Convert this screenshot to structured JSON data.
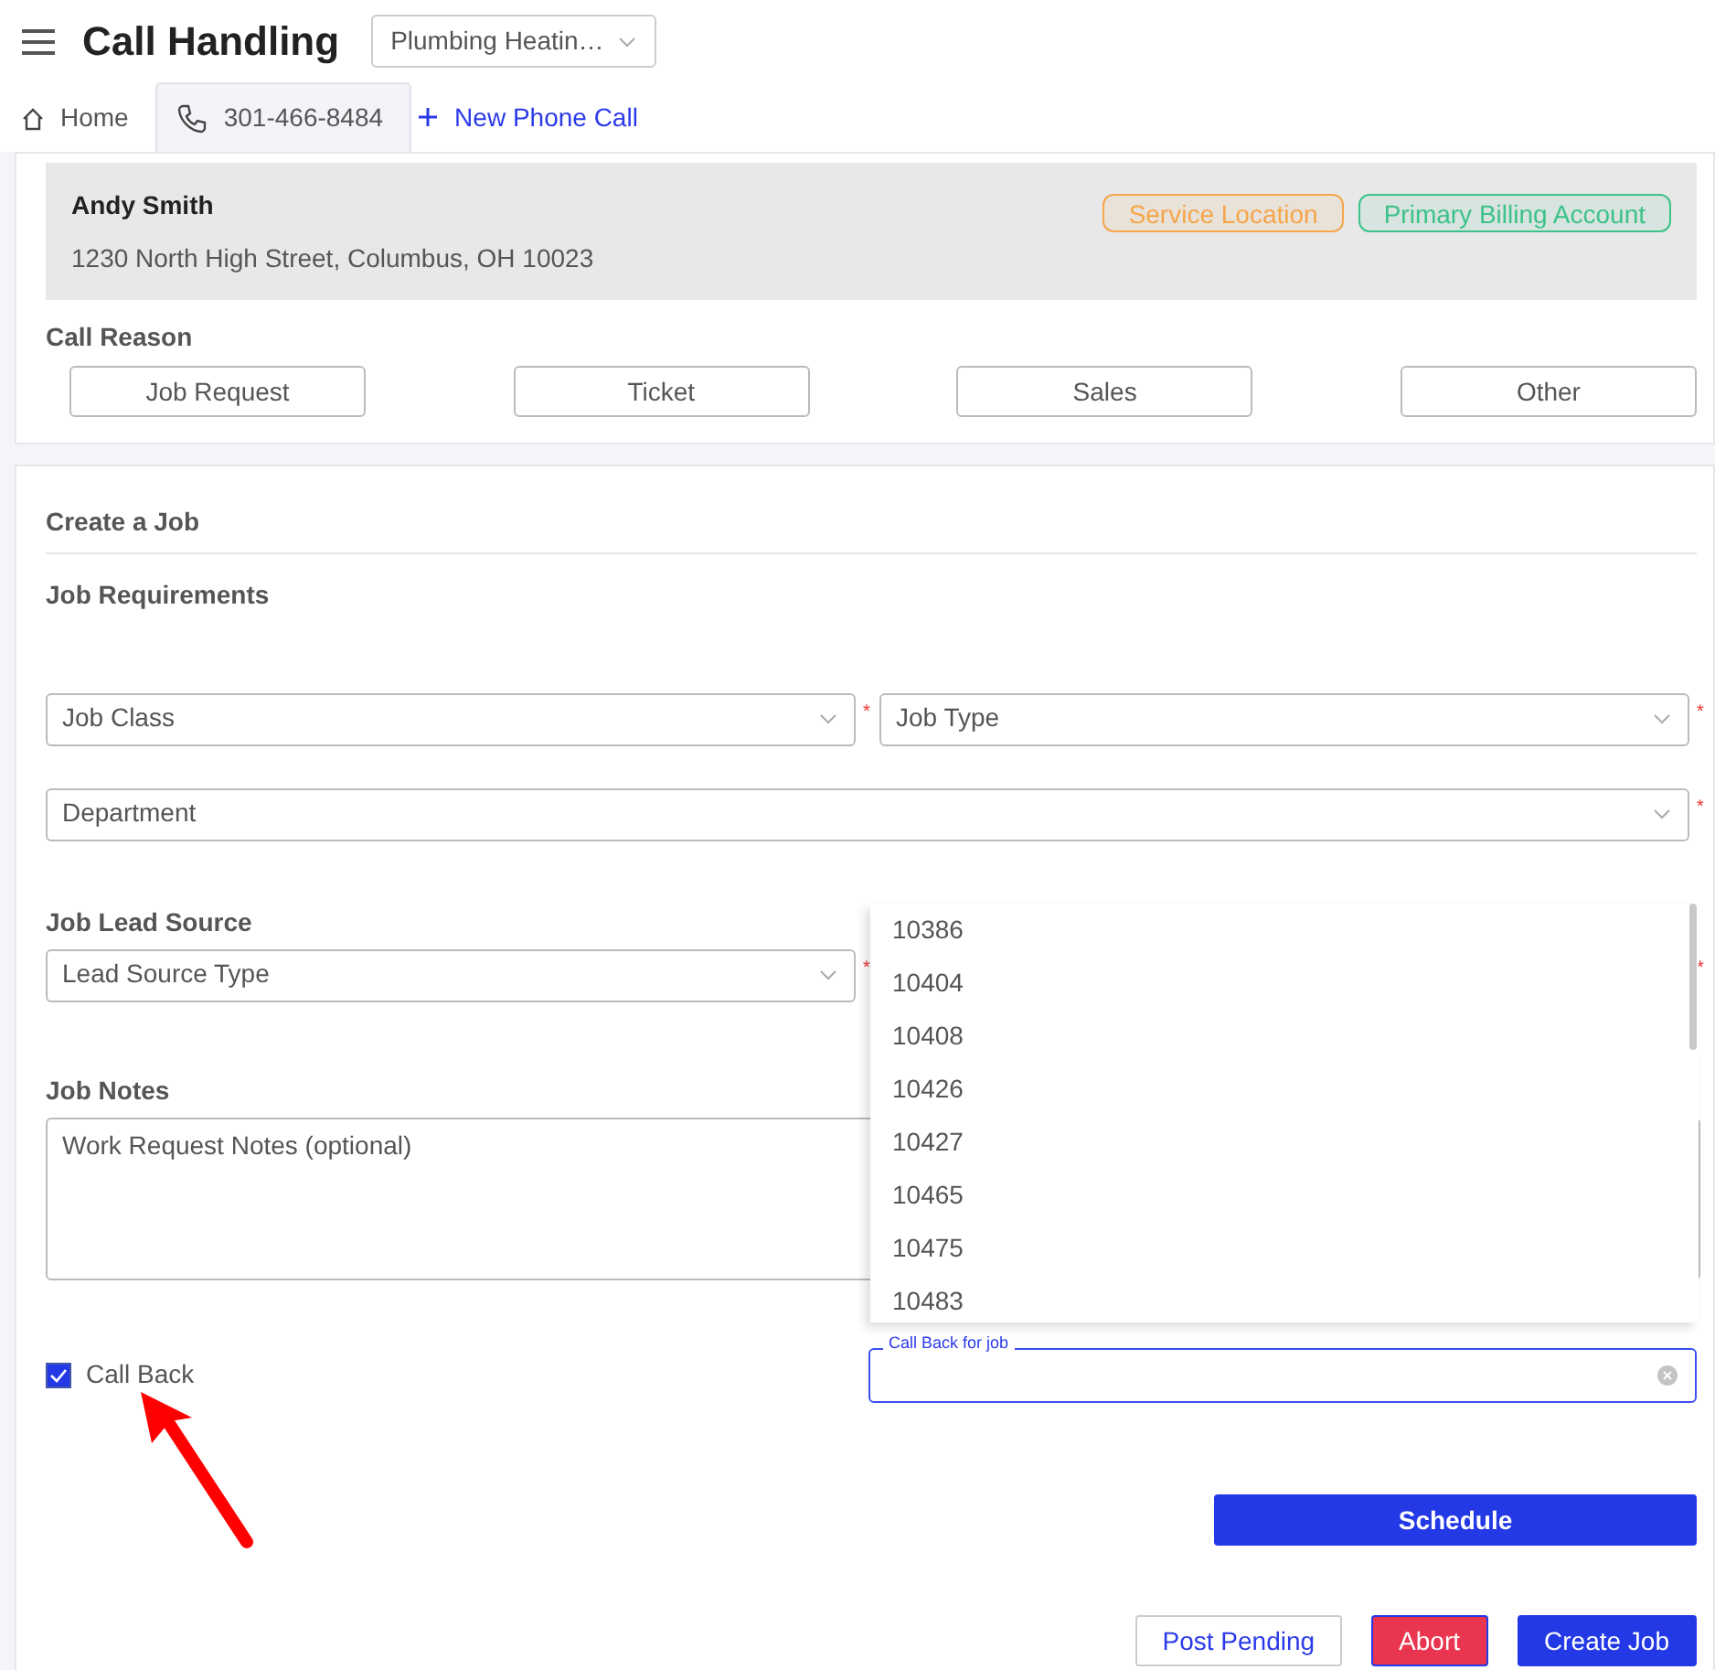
{
  "header": {
    "title": "Call Handling",
    "company_select": "Plumbing Heatin…"
  },
  "tabs": [
    {
      "label": "Home",
      "kind": "home",
      "selected": false
    },
    {
      "label": "301-466-8484",
      "kind": "phone",
      "selected": true
    }
  ],
  "new_call_link": "New Phone Call",
  "customer": {
    "name": "Andy Smith",
    "address": "1230 North High Street, Columbus, OH 10023",
    "tags": [
      {
        "label": "Service Location",
        "color": "#f5a54a"
      },
      {
        "label": "Primary Billing Account",
        "color": "#3cc28a"
      }
    ]
  },
  "call_reason": {
    "title": "Call Reason",
    "options": [
      "Job Request",
      "Ticket",
      "Sales",
      "Other"
    ]
  },
  "job": {
    "title": "Create a Job",
    "requirements_title": "Job Requirements",
    "rows": [
      [
        {
          "placeholder": "Job Class",
          "required_mark": "*"
        },
        {
          "placeholder": "Job Type",
          "required_mark": "*"
        }
      ],
      [
        {
          "placeholder": "Department",
          "required_mark": "*"
        }
      ]
    ],
    "lead_source": {
      "title": "Job Lead Source",
      "fields": [
        {
          "placeholder": "Lead Source Type",
          "required_mark": "*"
        },
        {
          "required_mark": "*"
        }
      ]
    },
    "notes": {
      "title": "Job Notes",
      "placeholder": "Work Request Notes (optional)"
    },
    "call_back": {
      "label": "Call Back",
      "checked": true
    },
    "call_back_job": {
      "label": "Call Back for job",
      "expanded": true,
      "options": [
        "10386",
        "10404",
        "10408",
        "10426",
        "10427",
        "10465",
        "10475",
        "10483"
      ]
    },
    "schedule_button": "Schedule"
  },
  "actions": [
    {
      "label": "Post Pending",
      "kind": "outline"
    },
    {
      "label": "Abort",
      "kind": "danger"
    },
    {
      "label": "Create Job",
      "kind": "primary"
    }
  ]
}
